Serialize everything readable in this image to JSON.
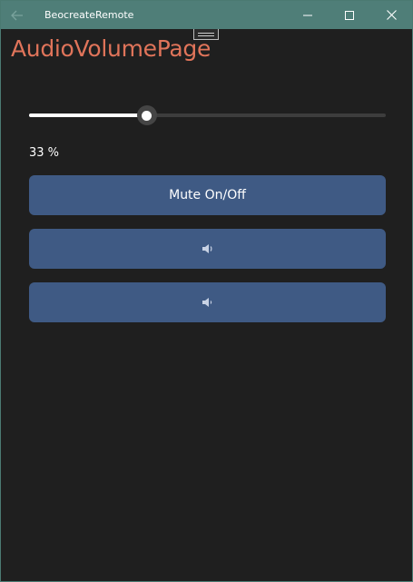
{
  "window": {
    "title": "BeocreateRemote"
  },
  "page": {
    "title": "AudioVolumePage",
    "volume_text": "33 %"
  },
  "volume_slider": {
    "value_percent": 33
  },
  "buttons": {
    "mute_label": "Mute On/Off",
    "volume_up_icon": "speaker-icon",
    "volume_down_icon": "speaker-icon"
  },
  "colors": {
    "titlebar": "#4f7e78",
    "background": "#1f1f1f",
    "page_title": "#e0745a",
    "button": "#3f5a84",
    "slider_fill": "#ffffff"
  }
}
